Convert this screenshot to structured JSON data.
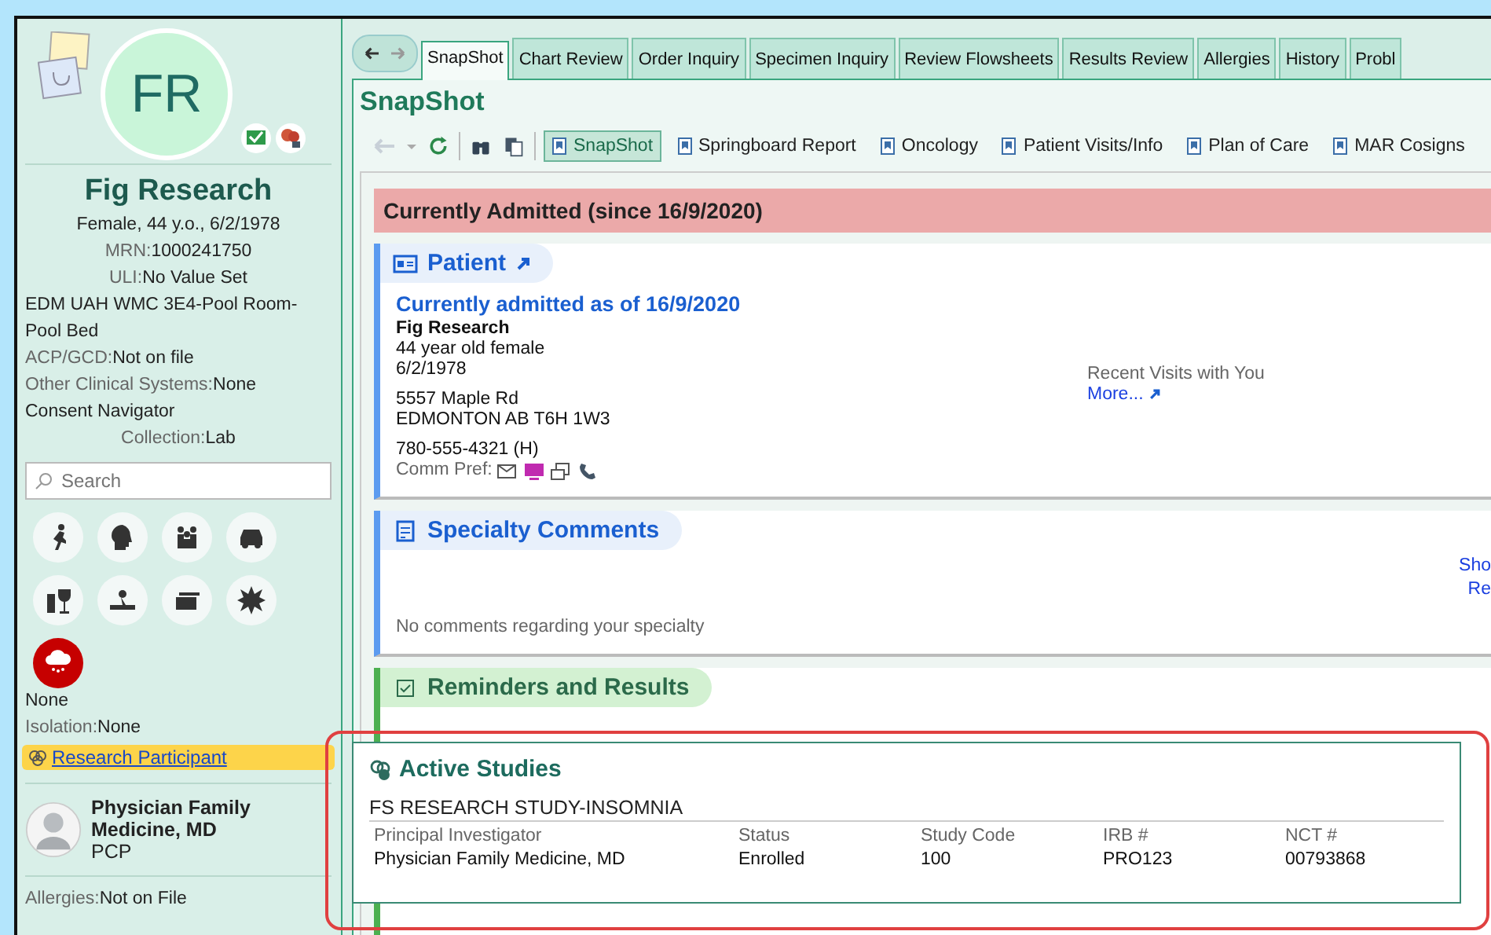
{
  "sidebar": {
    "initials": "FR",
    "name": "Fig Research",
    "info": [
      {
        "kind": "center",
        "value": "Female, 44 y.o., 6/2/1978"
      },
      {
        "kind": "center",
        "label": "MRN:",
        "value": "1000241750"
      },
      {
        "kind": "center",
        "label": "ULI:",
        "value": "No Value Set"
      },
      {
        "kind": "left",
        "value": "EDM UAH WMC 3E4-Pool Room-Pool Bed"
      },
      {
        "kind": "left",
        "label": "ACP/GCD:",
        "value": "Not on file"
      },
      {
        "kind": "left",
        "label": "Other Clinical Systems:",
        "value": "None"
      },
      {
        "kind": "left",
        "value": "Consent Navigator"
      },
      {
        "kind": "center",
        "label": "Collection:",
        "value": "Lab"
      }
    ],
    "search": {
      "placeholder": "Search"
    },
    "risk_icons": [
      {
        "active": false
      },
      {
        "active": false
      },
      {
        "active": false
      },
      {
        "active": false
      },
      {
        "active": false
      },
      {
        "active": false
      },
      {
        "active": false
      },
      {
        "active": false
      },
      {
        "active": true
      }
    ],
    "status": "None",
    "isolation": {
      "label": "Isolation:",
      "value": "None"
    },
    "research_link": "Research Participant",
    "pcp": {
      "name": "Physician Family Medicine, MD",
      "role": "PCP"
    },
    "allergies": {
      "label": "Allergies:",
      "value": "Not on File"
    }
  },
  "tabs": [
    {
      "label": "SnapShot",
      "selected": true
    },
    {
      "label": "Chart Review",
      "selected": false
    },
    {
      "label": "Order Inquiry",
      "selected": false
    },
    {
      "label": "Specimen Inquiry",
      "selected": false
    },
    {
      "label": "Review Flowsheets",
      "selected": false
    },
    {
      "label": "Results Review",
      "selected": false
    },
    {
      "label": "Allergies",
      "selected": false
    },
    {
      "label": "History",
      "selected": false
    },
    {
      "label": "Probl",
      "selected": false
    }
  ],
  "page_title": "SnapShot",
  "toolbar": [
    {
      "label": "SnapShot",
      "selected": true
    },
    {
      "label": "Springboard Report",
      "selected": false
    },
    {
      "label": "Oncology",
      "selected": false
    },
    {
      "label": "Patient Visits/Info",
      "selected": false
    },
    {
      "label": "Plan of Care",
      "selected": false
    },
    {
      "label": "MAR Cosigns",
      "selected": false
    }
  ],
  "banner": "Currently Admitted (since 16/9/2020)",
  "patient": {
    "title": "Patient",
    "admitted": "Currently admitted as of 16/9/2020",
    "name": "Fig Research",
    "age": "44 year old female",
    "dob": "6/2/1978",
    "address": [
      "5557 Maple Rd",
      "EDMONTON AB T6H 1W3"
    ],
    "phone": "780-555-4321 (H)",
    "comm_pref": "Comm Pref:",
    "recent_visits": "Recent Visits with You",
    "more": "More..."
  },
  "specialty": {
    "title": "Specialty Comments",
    "links": [
      "Sho",
      "Re"
    ],
    "empty": "No comments regarding your specialty"
  },
  "reminders": {
    "title": "Reminders and Results"
  },
  "popup": {
    "title": "Active Studies",
    "study": "FS RESEARCH STUDY-INSOMNIA",
    "columns": [
      "Principal Investigator",
      "Status",
      "Study Code",
      "IRB #",
      "NCT #"
    ],
    "row": [
      "Physician Family Medicine, MD",
      "Enrolled",
      "100",
      "PRO123",
      "00793868"
    ]
  }
}
